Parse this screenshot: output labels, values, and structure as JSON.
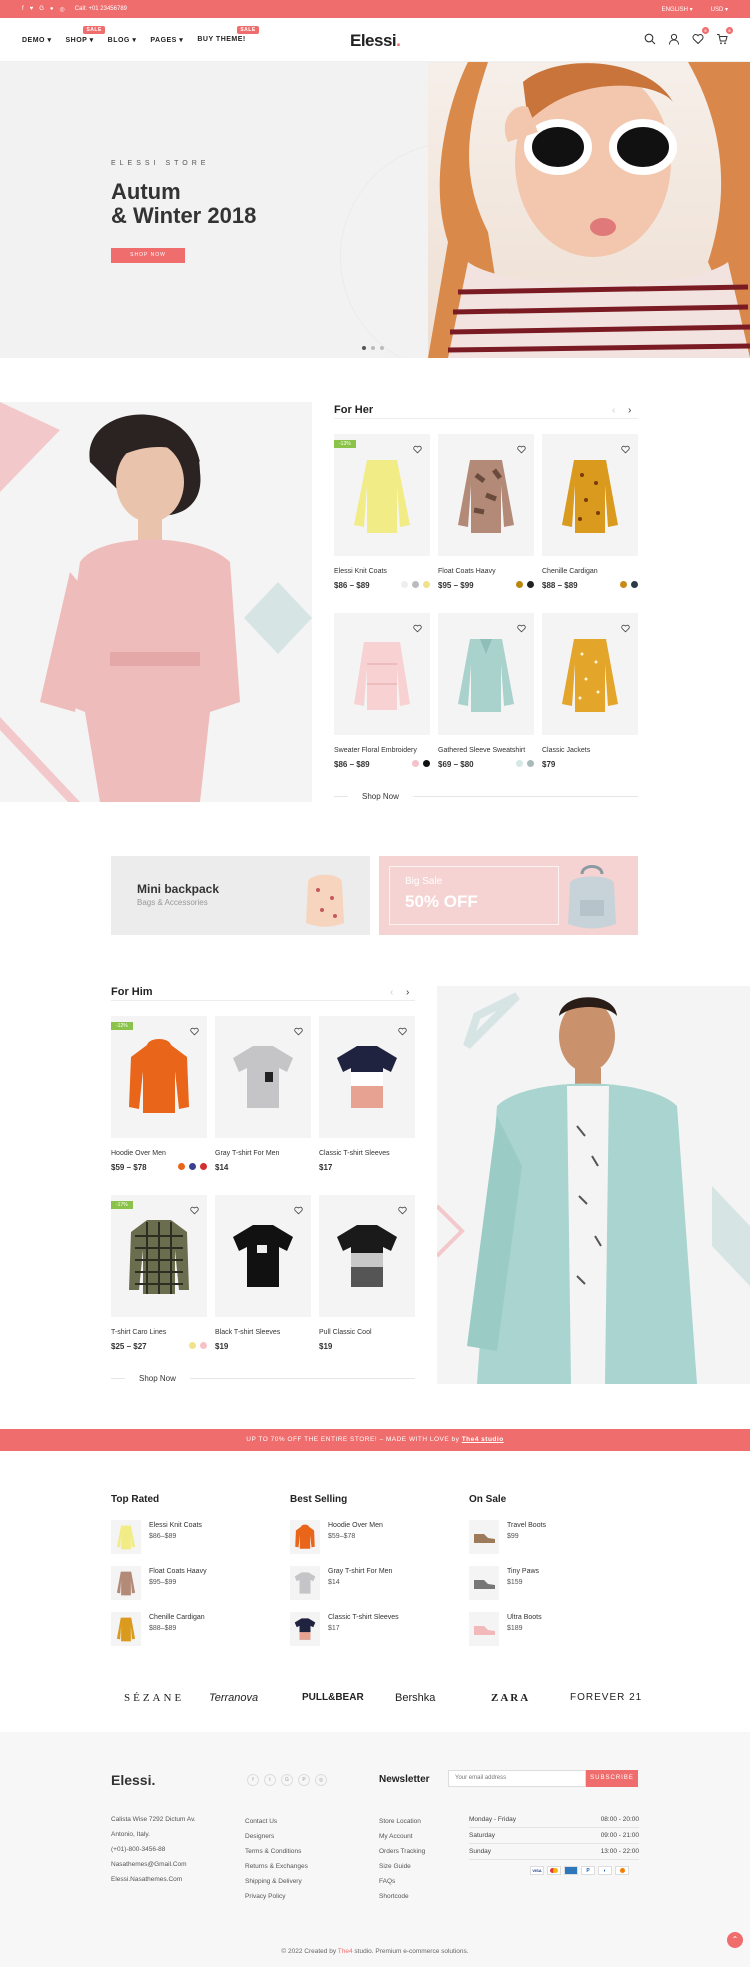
{
  "topbar": {
    "call": "Call: +01 23456789",
    "lang": "ENGLISH",
    "currency": "USD"
  },
  "nav": {
    "items": [
      "DEMO",
      "SHOP",
      "BLOG",
      "PAGES",
      "BUY THEME!"
    ],
    "hot_label": "SALE"
  },
  "logo": {
    "text": "Elessi",
    "dot": "."
  },
  "header": {
    "wishlist_count": "0",
    "cart_count": "0"
  },
  "hero": {
    "kicker": "ELESSI STORE",
    "title_line1": "Autum",
    "title_line2": "& Winter 2018",
    "button": "SHOP NOW"
  },
  "for_her": {
    "title": "For Her",
    "sale_badge": "-13%",
    "products": [
      {
        "name": "Elessi Knit Coats",
        "price": "$86 – $89"
      },
      {
        "name": "Float Coats Haavy",
        "price": "$95 – $99"
      },
      {
        "name": "Chenille Cardigan",
        "price": "$88 – $89"
      },
      {
        "name": "Sweater Floral Embroidery",
        "price": "$86 – $89"
      },
      {
        "name": "Gathered Sleeve Sweatshirt",
        "price": "$69 – $80"
      },
      {
        "name": "Classic Jackets",
        "price": "$79"
      }
    ],
    "shop_now": "Shop Now"
  },
  "banners": {
    "mini_title": "Mini backpack",
    "mini_sub": "Bags & Accessories",
    "sale_title": "Big Sale",
    "sale_value": "50% OFF"
  },
  "for_him": {
    "title": "For Him",
    "sale_badge": "-12%",
    "sale_badge2": "-17%",
    "products": [
      {
        "name": "Hoodie Over Men",
        "price": "$59 – $78"
      },
      {
        "name": "Gray T-shirt For Men",
        "price": "$14"
      },
      {
        "name": "Classic T-shirt Sleeves",
        "price": "$17"
      },
      {
        "name": "T-shirt Caro Lines",
        "price": "$25 – $27"
      },
      {
        "name": "Black T-shirt Sleeves",
        "price": "$19"
      },
      {
        "name": "Pull Classic Cool",
        "price": "$19"
      }
    ],
    "shop_now": "Shop Now"
  },
  "promo": {
    "text": "UP TO 70% OFF THE ENTIRE STORE! – MADE WITH LOVE by",
    "link": "The4 studio"
  },
  "lists": {
    "top_rated": {
      "title": "Top Rated",
      "items": [
        {
          "name": "Elessi Knit Coats",
          "price": "$86–$89"
        },
        {
          "name": "Float Coats Haavy",
          "price": "$95–$99"
        },
        {
          "name": "Chenille Cardigan",
          "price": "$88–$89"
        }
      ]
    },
    "best_selling": {
      "title": "Best Selling",
      "items": [
        {
          "name": "Hoodie Over Men",
          "price": "$59–$78"
        },
        {
          "name": "Gray T-shirt For Men",
          "price": "$14"
        },
        {
          "name": "Classic T-shirt Sleeves",
          "price": "$17"
        }
      ]
    },
    "on_sale": {
      "title": "On Sale",
      "items": [
        {
          "name": "Travel Boots",
          "price": "$99"
        },
        {
          "name": "Tiny Paws",
          "price": "$159"
        },
        {
          "name": "Ultra Boots",
          "price": "$189"
        }
      ]
    }
  },
  "brands": [
    "SÉZANE",
    "Terranova",
    "PULL&BEAR",
    "Bershka",
    "ZARA",
    "FOREVER 21"
  ],
  "footer": {
    "logo": "Elessi.",
    "address1": "Calista Wise 7292 Dictum Av.",
    "address2": "Antonio, Italy.",
    "phone": "(+01)-800-3456-88",
    "email1": "Nasathemes@Gmail.Com",
    "email2": "Elessi.Nasathemes.Com",
    "links1": [
      "Contact Us",
      "Designers",
      "Terms & Conditions",
      "Returns & Exchanges",
      "Shipping & Delivery",
      "Privacy Policy"
    ],
    "links2": [
      "Store Location",
      "My Account",
      "Orders Tracking",
      "Size Guide",
      "FAQs",
      "Shortcode"
    ],
    "newsletter_title": "Newsletter",
    "newsletter_placeholder": "Your email address",
    "subscribe": "SUBSCRIBE",
    "hours": [
      {
        "day": "Monday - Friday",
        "time": "08:00 - 20:00"
      },
      {
        "day": "Saturday",
        "time": "09:00 - 21:00"
      },
      {
        "day": "Sunday",
        "time": "13:00 - 22:00"
      }
    ],
    "copyright": "© 2022 Created by",
    "copyright_link": "The4",
    "copyright_end": "studio. Premium e-commerce solutions."
  }
}
